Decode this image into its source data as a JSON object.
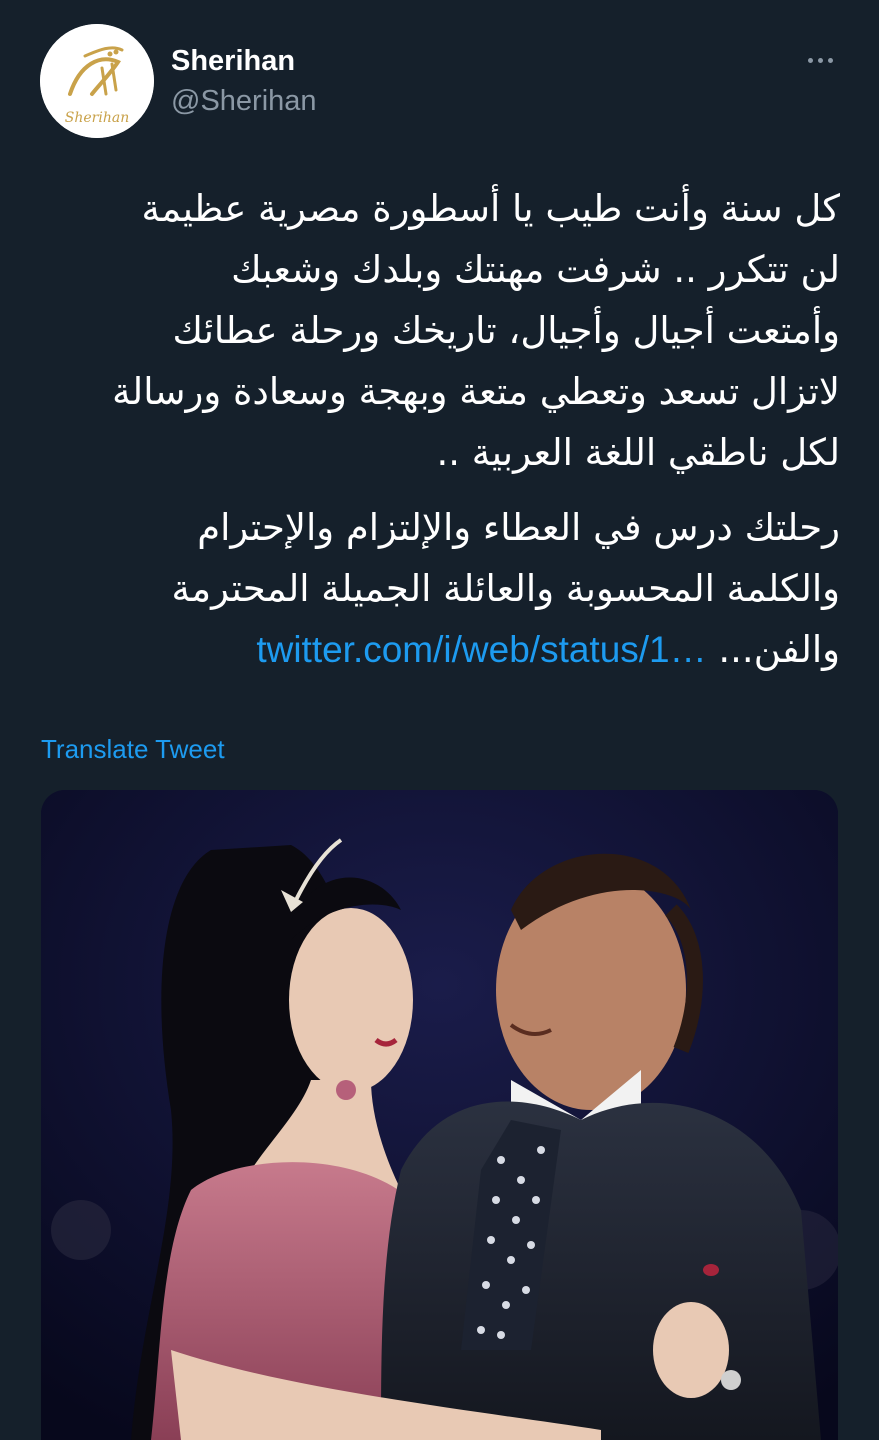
{
  "header": {
    "display_name": "Sherihan",
    "handle": "@Sherihan",
    "more_icon": "more-horizontal-icon",
    "avatar_logo_text": "Sherihan"
  },
  "tweet": {
    "paragraph1_lines": [
      "كل سنة وأنت طيب يا أسطورة مصرية عظيمة",
      "لن تتكرر .. شرفت مهنتك وبلدك وشعبك",
      "وأمتعت أجيال وأجيال، تاريخك ورحلة عطائك",
      "لاتزال تسعد وتعطي متعة وبهجة وسعادة ورسالة",
      "لكل ناطقي اللغة العربية .."
    ],
    "paragraph2_lines": [
      " رحلتك درس في العطاء والإلتزام والإحترام",
      "والكلمة المحسوبة والعائلة الجميلة المحترمة"
    ],
    "paragraph2_last_prefix": "والفن...",
    "link_text": "twitter.com/i/web/status/1…"
  },
  "translate_label": "Translate Tweet",
  "colors": {
    "background": "#15202b",
    "link": "#1d9bf0",
    "secondary_text": "#8b98a5"
  }
}
